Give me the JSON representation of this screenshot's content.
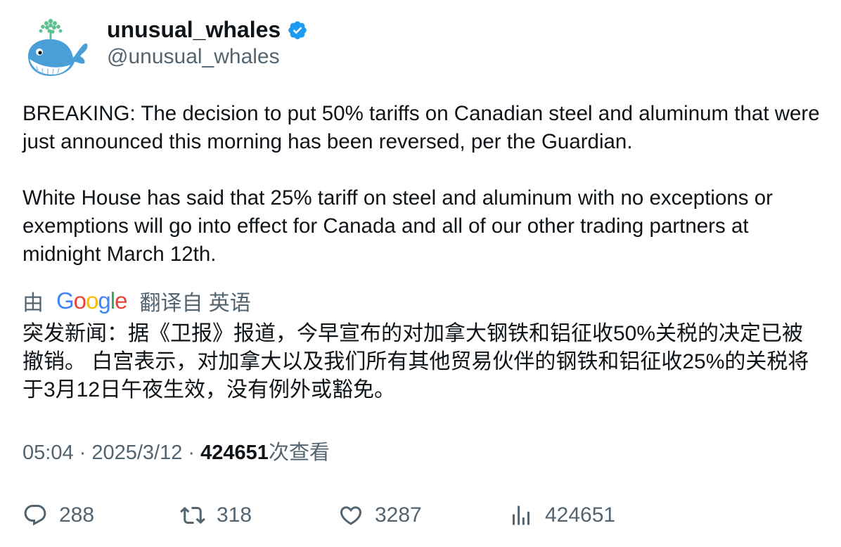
{
  "author": {
    "display_name": "unusual_whales",
    "handle": "@unusual_whales",
    "verified": true,
    "avatar_icon": "whale-icon",
    "verified_color": "#1d9bf0"
  },
  "tweet": {
    "text": "BREAKING: The decision to put 50% tariffs on Canadian steel and aluminum that were just announced this morning has been reversed, per the Guardian.\n\nWhite House has said that 25% tariff on steel and aluminum with no exceptions or exemptions will go into effect for Canada and all of our other trading partners at midnight March 12th."
  },
  "translation": {
    "by_prefix": "由",
    "provider": "Google",
    "label": "翻译自 英语",
    "text": "突发新闻：据《卫报》报道，今早宣布的对加拿大钢铁和铝征收50%关税的决定已被撤销。 白宫表示，对加拿大以及我们所有其他贸易伙伴的钢铁和铝征收25%的关税将于3月12日午夜生效，没有例外或豁免。"
  },
  "meta": {
    "time": "05:04",
    "separator": " · ",
    "date": "2025/3/12",
    "views_count": "424651",
    "views_label": "次查看"
  },
  "actions": {
    "replies": "288",
    "retweets": "318",
    "likes": "3287",
    "views": "424651"
  },
  "colors": {
    "text_primary": "#0f1419",
    "text_secondary": "#536471",
    "google_blue": "#4285f4",
    "google_red": "#ea4335",
    "google_yellow": "#fbbc05",
    "google_green": "#34a853"
  }
}
